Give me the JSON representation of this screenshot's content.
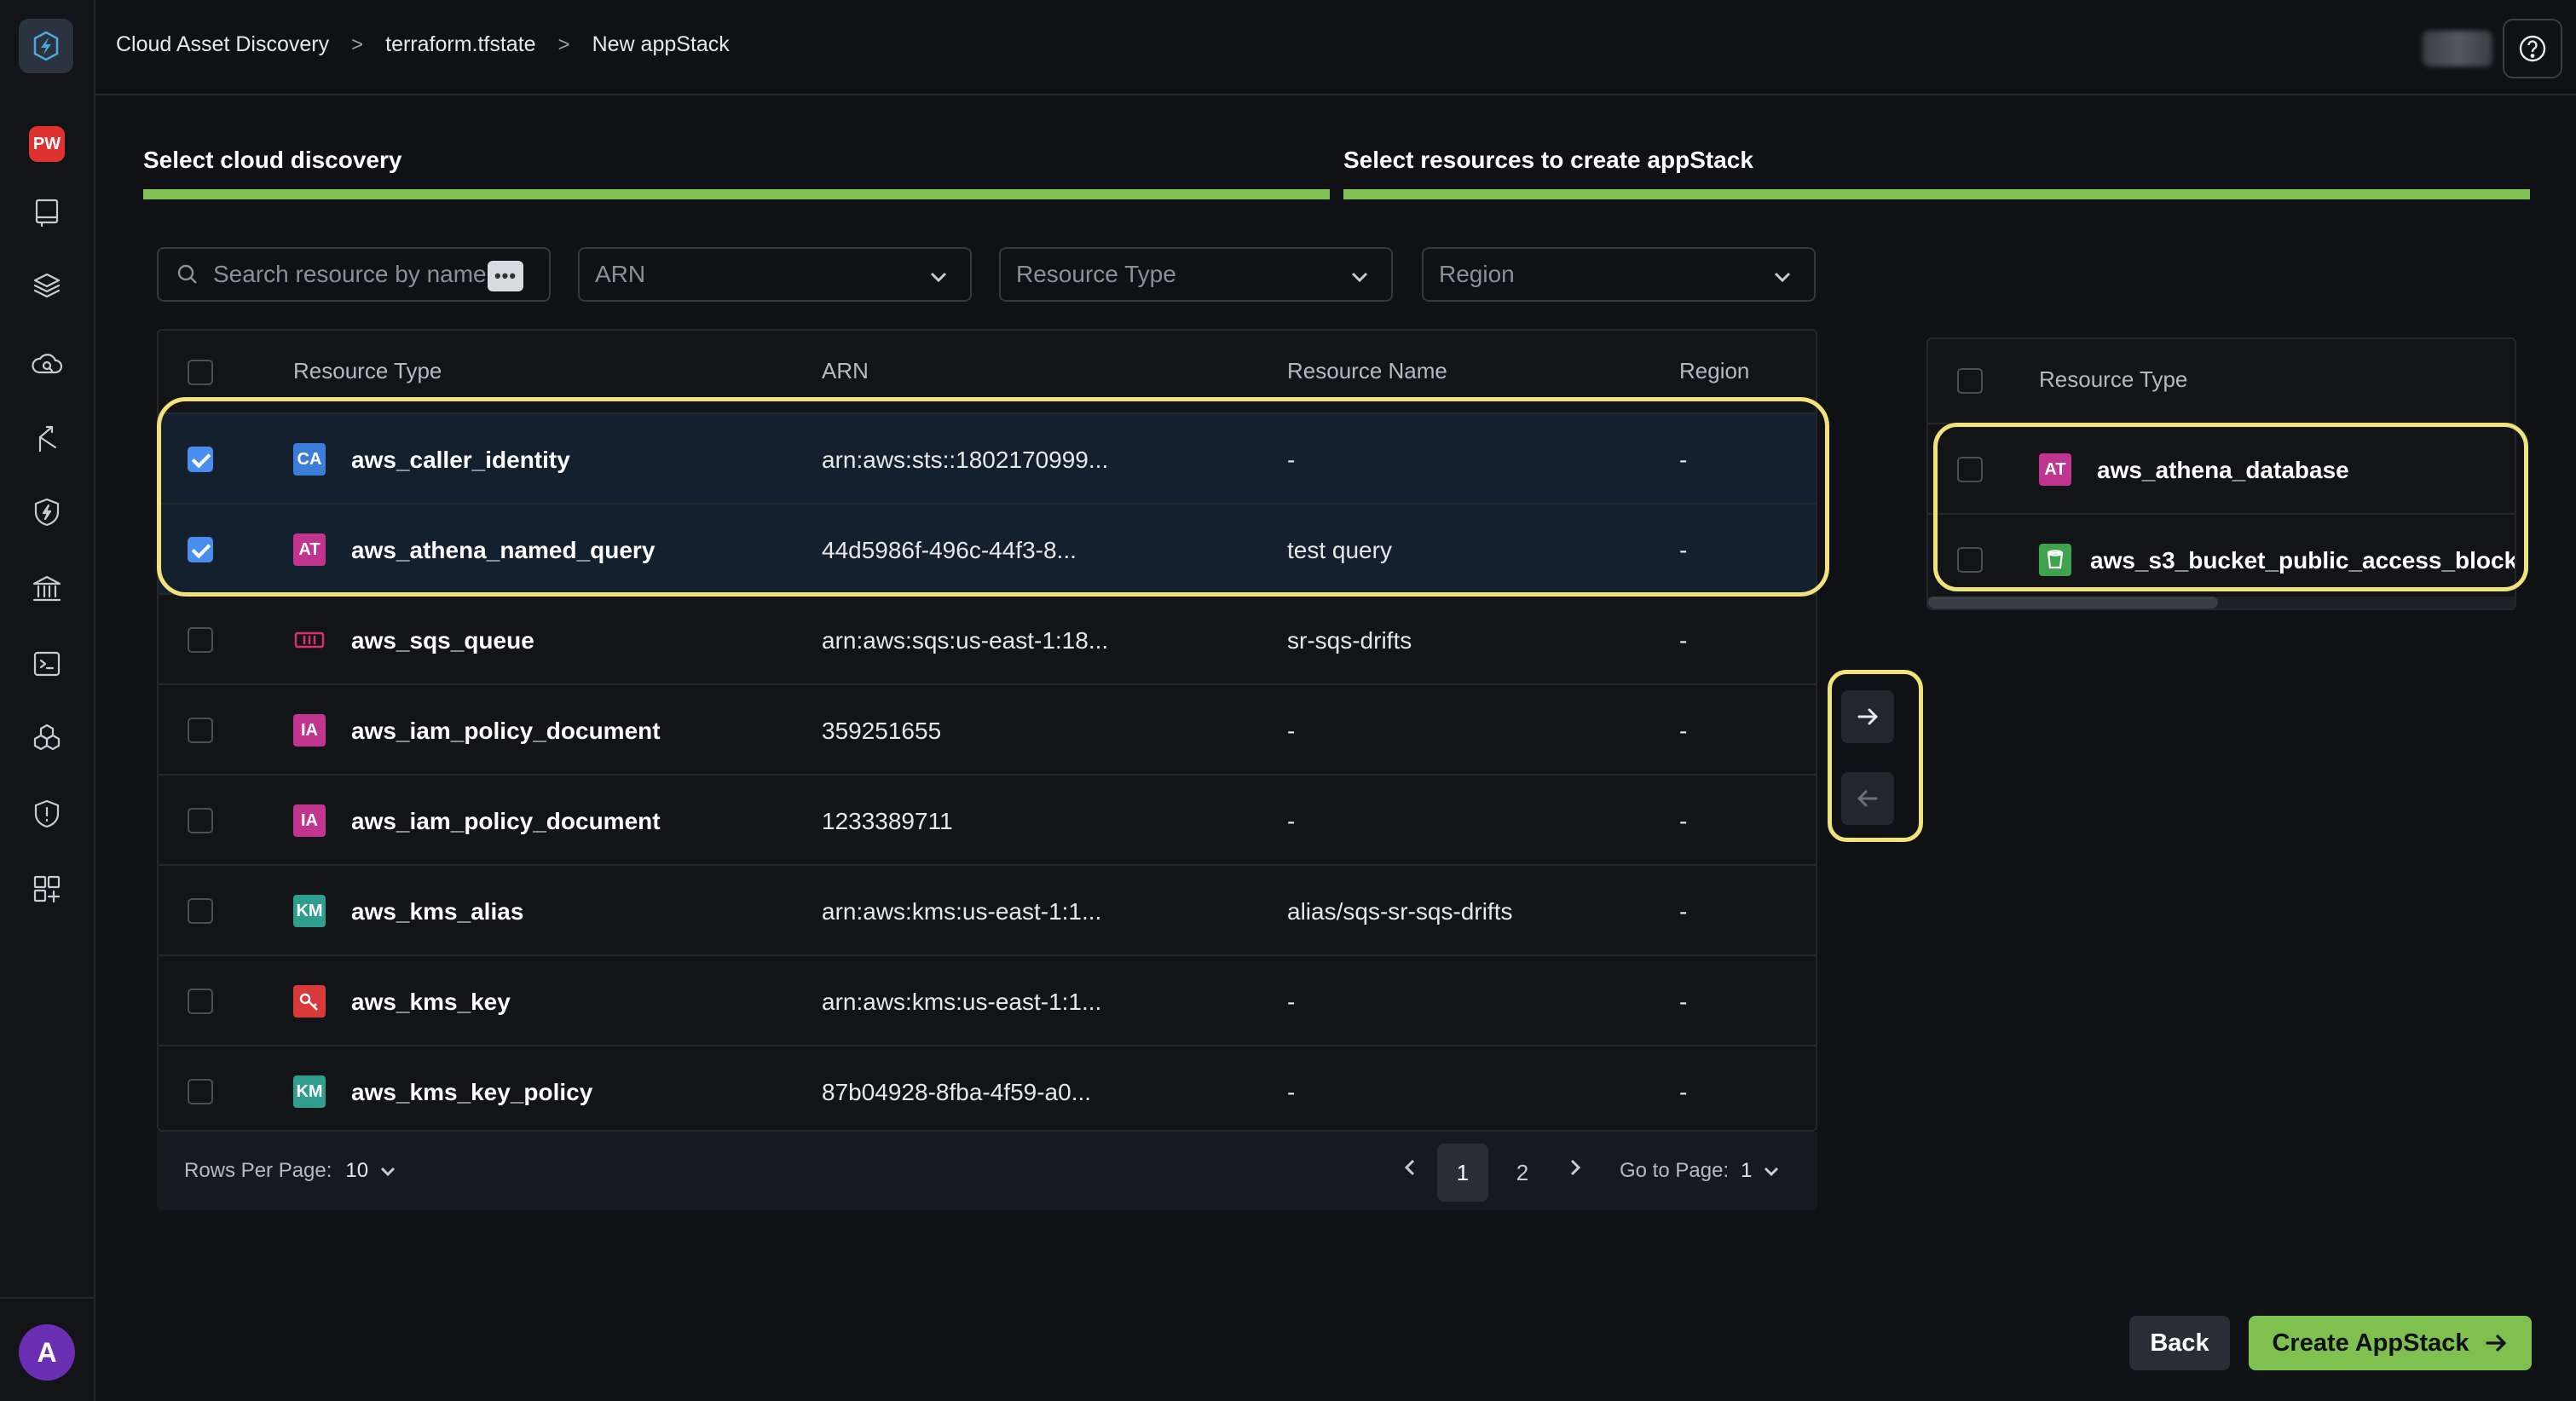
{
  "sidebar": {
    "badge": "PW",
    "avatar": "A",
    "icons": [
      "workspace-icon",
      "layers-icon",
      "cloud-search-icon",
      "branch-icon",
      "shield-bolt-icon",
      "bank-icon",
      "terminal-icon",
      "cubes-icon",
      "shield-alert-icon",
      "apps-add-icon"
    ]
  },
  "breadcrumb": {
    "items": [
      "Cloud Asset Discovery",
      "terraform.tfstate",
      "New appStack"
    ]
  },
  "steps": {
    "step1": "Select cloud discovery",
    "step2": "Select resources to create appStack",
    "accent": "#7fc04e"
  },
  "filters": {
    "search_placeholder": "Search resource by name",
    "dots": "•••",
    "arn": "ARN",
    "resource_type": "Resource Type",
    "region": "Region"
  },
  "table": {
    "headers": {
      "resource_type": "Resource Type",
      "arn": "ARN",
      "resource_name": "Resource Name",
      "region": "Region"
    },
    "rows": [
      {
        "checked": true,
        "icon": "CA",
        "icon_color": "#3b7dd8",
        "type": "aws_caller_identity",
        "arn": "arn:aws:sts::1802170999...",
        "name": "-",
        "region": "-"
      },
      {
        "checked": true,
        "icon": "AT",
        "icon_color": "#c2358f",
        "type": "aws_athena_named_query",
        "arn": "44d5986f-496c-44f3-8...",
        "name": "test query",
        "region": "-"
      },
      {
        "checked": false,
        "icon": "",
        "icon_color": "#d6336c",
        "type": "aws_sqs_queue",
        "arn": "arn:aws:sqs:us-east-1:18...",
        "name": "sr-sqs-drifts",
        "region": "-"
      },
      {
        "checked": false,
        "icon": "IA",
        "icon_color": "#c2358f",
        "type": "aws_iam_policy_document",
        "arn": "359251655",
        "name": "-",
        "region": "-"
      },
      {
        "checked": false,
        "icon": "IA",
        "icon_color": "#c2358f",
        "type": "aws_iam_policy_document",
        "arn": "1233389711",
        "name": "-",
        "region": "-"
      },
      {
        "checked": false,
        "icon": "KM",
        "icon_color": "#2f9e8f",
        "type": "aws_kms_alias",
        "arn": "arn:aws:kms:us-east-1:1...",
        "name": "alias/sqs-sr-sqs-drifts",
        "region": "-"
      },
      {
        "checked": false,
        "icon": "",
        "icon_color": "#d63a3a",
        "type": "aws_kms_key",
        "arn": "arn:aws:kms:us-east-1:1...",
        "name": "-",
        "region": "-"
      },
      {
        "checked": false,
        "icon": "KM",
        "icon_color": "#2f9e8f",
        "type": "aws_kms_key_policy",
        "arn": "87b04928-8fba-4f59-a0...",
        "name": "-",
        "region": "-"
      }
    ]
  },
  "pagination": {
    "rows_per_page_label": "Rows Per Page:",
    "rows_per_page": "10",
    "pages": [
      "1",
      "2"
    ],
    "current_page": "1",
    "goto_label": "Go to Page:",
    "goto_value": "1"
  },
  "right_table": {
    "header": "Resource Type",
    "rows": [
      {
        "icon": "AT",
        "icon_color": "#c2358f",
        "type": "aws_athena_database"
      },
      {
        "icon": "",
        "icon_color": "#3fa34d",
        "type": "aws_s3_bucket_public_access_block"
      }
    ]
  },
  "buttons": {
    "back": "Back",
    "create": "Create AppStack"
  },
  "colors": {
    "highlight": "#f2e27a",
    "checkbox": "#4a8ff0"
  }
}
